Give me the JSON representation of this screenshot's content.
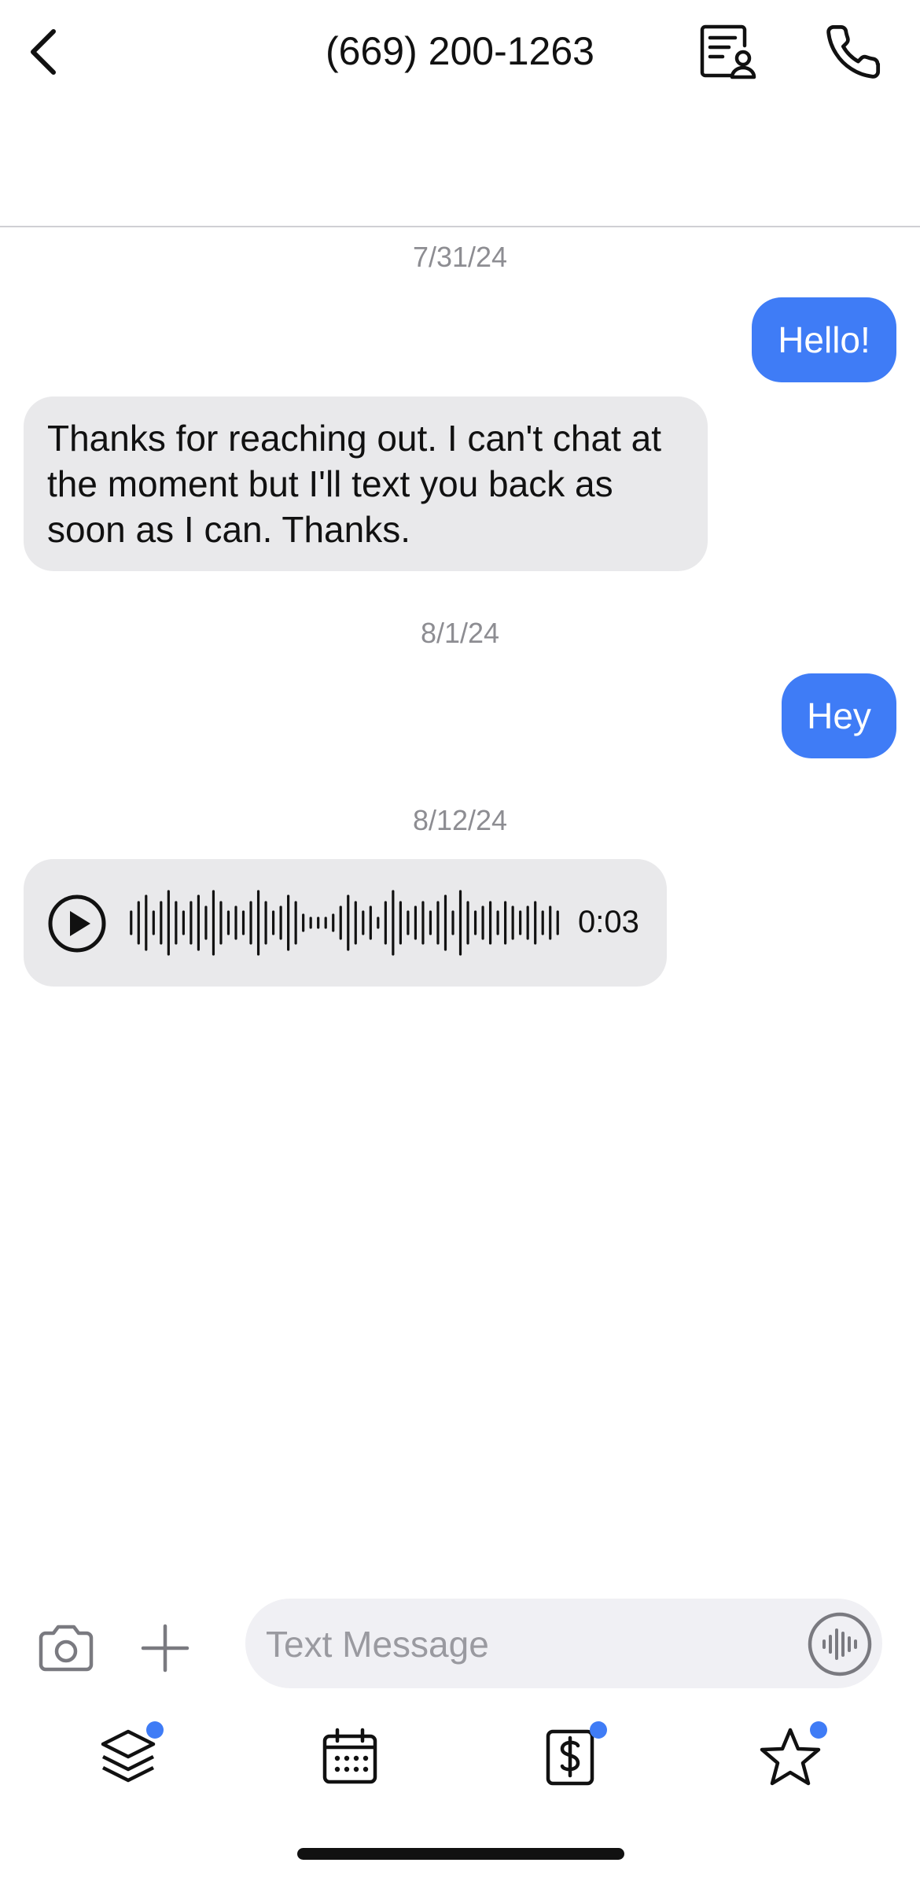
{
  "header": {
    "title": "(669) 200-1263",
    "icons": [
      "chevron-left-icon",
      "contact-card-icon",
      "phone-icon"
    ]
  },
  "messages": [
    {
      "type": "date",
      "text": "7/31/24"
    },
    {
      "type": "outgoing",
      "text": "Hello!"
    },
    {
      "type": "incoming",
      "text": "Thanks for reaching out. I can't chat at the moment but I'll text you back as soon as I can. Thanks."
    },
    {
      "type": "date",
      "text": "8/1/24"
    },
    {
      "type": "outgoing",
      "text": "Hey"
    },
    {
      "type": "date",
      "text": "8/12/24"
    },
    {
      "type": "voice",
      "duration": "0:03"
    }
  ],
  "composer": {
    "placeholder": "Text Message",
    "icons": [
      "camera-icon",
      "plus-icon",
      "voice-memo-icon"
    ]
  },
  "tabbar": {
    "items": [
      {
        "icon": "layers-icon",
        "badge": true
      },
      {
        "icon": "calendar-icon",
        "badge": false
      },
      {
        "icon": "dollar-icon",
        "badge": true
      },
      {
        "icon": "star-icon",
        "badge": true
      }
    ]
  },
  "colors": {
    "accent": "#3f7cf6",
    "incoming_bubble": "#e9e9eb",
    "date_text": "#8d8d92",
    "input_bg": "#f0f0f4"
  }
}
